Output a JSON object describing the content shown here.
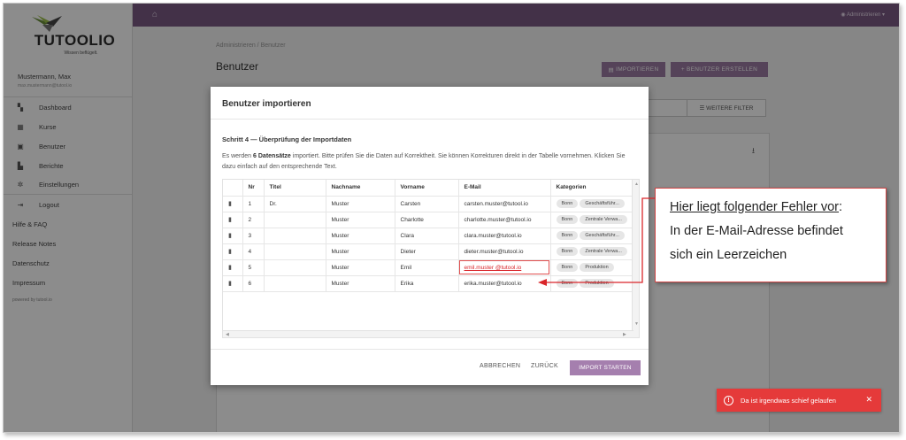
{
  "app": {
    "brand": "TUTOOLIO",
    "tagline": "Wissen beflügelt.",
    "user_name": "Mustermann, Max",
    "user_email": "max.mustermann@tutool.io",
    "admin_label": "Administrieren"
  },
  "sidebar": {
    "items": [
      {
        "label": "Dashboard",
        "icon": "dashboard-icon",
        "glyph": "▚"
      },
      {
        "label": "Kurse",
        "icon": "grid-icon",
        "glyph": "▦"
      },
      {
        "label": "Benutzer",
        "icon": "user-box-icon",
        "glyph": "▣"
      },
      {
        "label": "Berichte",
        "icon": "bar-chart-icon",
        "glyph": "▙"
      },
      {
        "label": "Einstellungen",
        "icon": "gear-icon",
        "glyph": "✲"
      },
      {
        "label": "Logout",
        "icon": "logout-icon",
        "glyph": "⇥"
      }
    ],
    "links": [
      "Hilfe & FAQ",
      "Release Notes",
      "Datenschutz",
      "Impressum"
    ],
    "powered": "powered by tutool.io"
  },
  "main": {
    "breadcrumb": "Administrieren / Benutzer",
    "title": "Benutzer",
    "import_button": "IMPORTIEREN",
    "create_button": "+ BENUTZER ERSTELLEN",
    "filter_button": "WEITERE FILTER"
  },
  "modal": {
    "title": "Benutzer importieren",
    "step": "Schritt 4 — Überprüfung der Importdaten",
    "desc_prefix": "Es werden ",
    "desc_count": "6 Datensätze",
    "desc_suffix": " importiert. Bitte prüfen Sie die Daten auf Korrektheit. Sie können Korrekturen direkt in der Tabelle vornehmen. Klicken Sie dazu einfach auf den entsprechende Text.",
    "columns": [
      "",
      "Nr",
      "Titel",
      "Nachname",
      "Vorname",
      "E-Mail",
      "Kategorien"
    ],
    "rows": [
      {
        "nr": "1",
        "titel": "Dr.",
        "nachname": "Muster",
        "vorname": "Carsten",
        "email": "carsten.muster@tutool.io",
        "cats": [
          "Bonn",
          "Geschäftsführ..."
        ]
      },
      {
        "nr": "2",
        "titel": "",
        "nachname": "Muster",
        "vorname": "Charlotte",
        "email": "charlotte.muster@tutool.io",
        "cats": [
          "Bonn",
          "Zentrale Verwa..."
        ]
      },
      {
        "nr": "3",
        "titel": "",
        "nachname": "Muster",
        "vorname": "Clara",
        "email": "clara.muster@tutool.io",
        "cats": [
          "Bonn",
          "Geschäftsführ..."
        ]
      },
      {
        "nr": "4",
        "titel": "",
        "nachname": "Muster",
        "vorname": "Dieter",
        "email": "dieter.muster@tutool.io",
        "cats": [
          "Bonn",
          "Zentrale Verwa..."
        ]
      },
      {
        "nr": "5",
        "titel": "",
        "nachname": "Muster",
        "vorname": "Emil",
        "email": "emil.muster @tutool.io",
        "cats": [
          "Bonn",
          "Produktion"
        ],
        "error": true
      },
      {
        "nr": "6",
        "titel": "",
        "nachname": "Muster",
        "vorname": "Erika",
        "email": "erika.muster@tutool.io",
        "cats": [
          "Bonn",
          "Produktion"
        ]
      }
    ],
    "cancel": "ABBRECHEN",
    "back": "ZURÜCK",
    "start": "IMPORT STARTEN"
  },
  "annotation": {
    "line1_underlined": "Hier liegt folgender Fehler vor",
    "line1_rest": ":",
    "line2": "In der E-Mail-Adresse befindet",
    "line3": "sich ein Leerzeichen"
  },
  "toast": {
    "message": "Da ist irgendwas schief gelaufen",
    "close": "✕",
    "icon": "!"
  },
  "colors": {
    "topbar": "#7a5a83",
    "primary": "#a57fae",
    "error": "#e53a3a"
  }
}
